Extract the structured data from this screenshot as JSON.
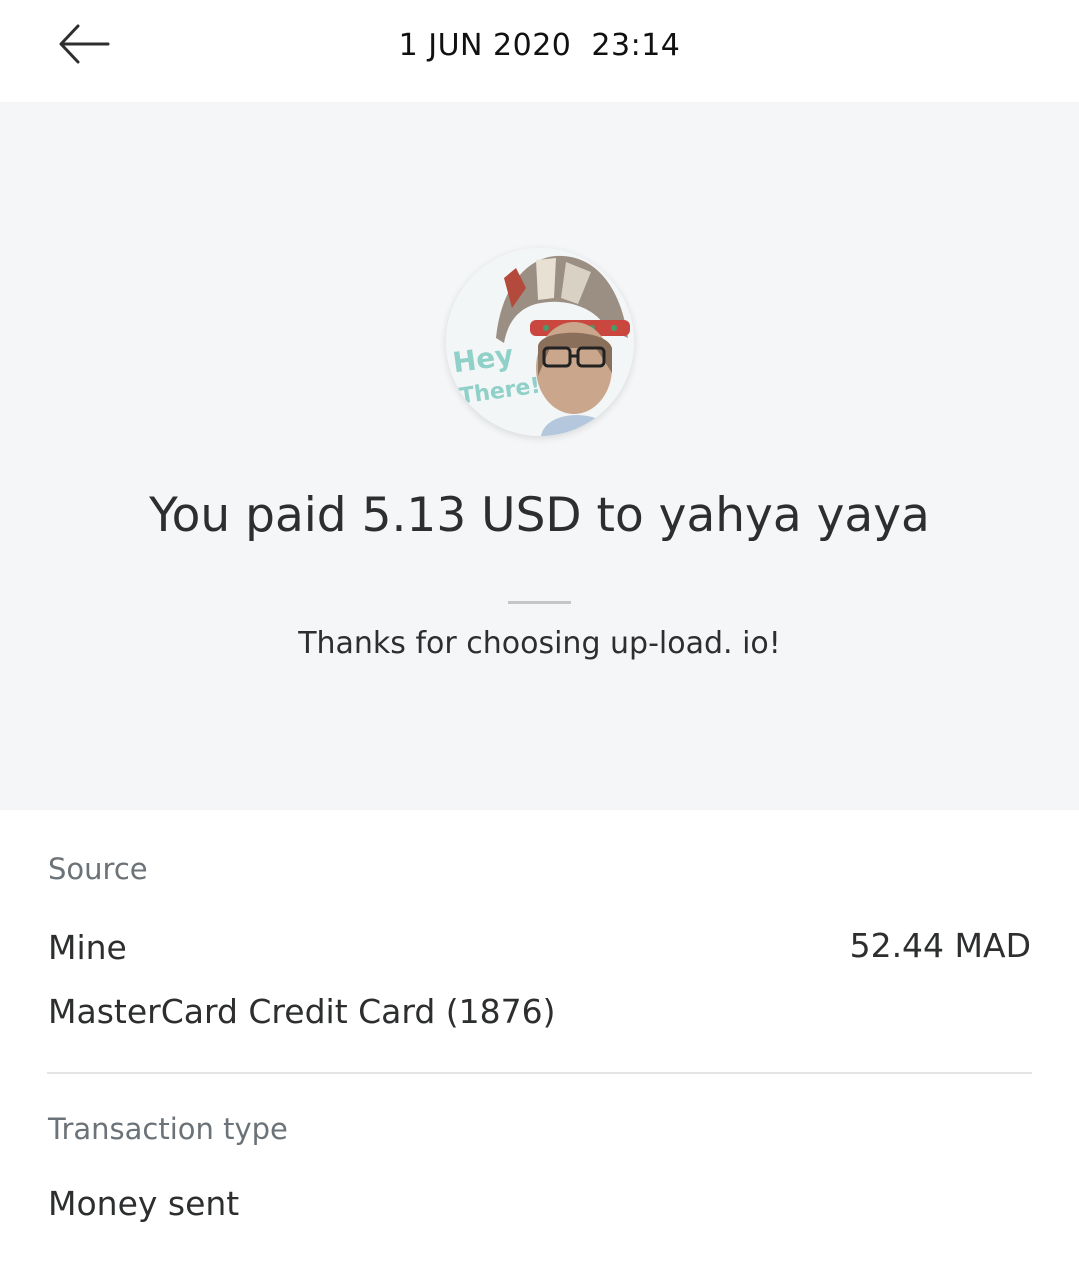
{
  "header": {
    "back_icon": "arrow-left-icon",
    "datetime": "1 JUN 2020  23:14"
  },
  "summary": {
    "avatar_icon": "recipient-avatar",
    "avatar_caption": "Hey There!",
    "headline": "You paid 5.13 USD to yahya yaya",
    "message": "Thanks for choosing up-load. io!"
  },
  "source": {
    "label": "Source",
    "name": "Mine",
    "amount": "52.44 MAD",
    "method": "MasterCard Credit Card (1876)"
  },
  "transaction_type": {
    "label": "Transaction type",
    "value": "Money sent"
  }
}
